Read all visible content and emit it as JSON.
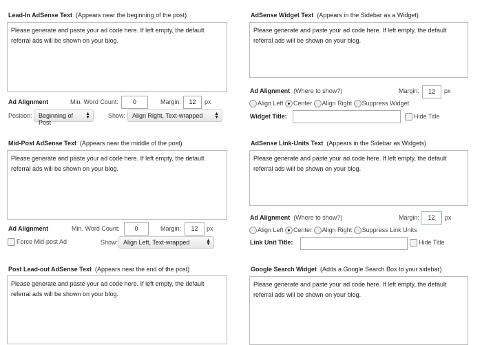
{
  "placeholder_text": "Please generate and paste your ad code here. If left empty, the default referral ads will be shown on your blog.",
  "left": {
    "leadin": {
      "title": "Lead-In AdSense Text",
      "note": "(Appears near the beginning of the post)",
      "align_label": "Ad Alignment",
      "min_word_label": "Min. Word Count:",
      "min_word": "0",
      "margin_label": "Margin:",
      "margin": "12",
      "px": "px",
      "position_label": "Position:",
      "position": "Beginning of Post",
      "show_label": "Show:",
      "show": "Align Right, Text-wrapped"
    },
    "midpost": {
      "title": "Mid-Post AdSense Text",
      "note": "(Appears near the middle of the post)",
      "align_label": "Ad Alignment",
      "min_word_label": "Min. Word Count:",
      "min_word": "0",
      "margin_label": "Margin:",
      "margin": "12",
      "px": "px",
      "force_label": "Force Mid-post Ad",
      "show_label": "Show:",
      "show": "Align Left, Text-wrapped"
    },
    "leadout": {
      "title": "Post Lead-out AdSense Text",
      "note": "(Appears near the end of the post)"
    }
  },
  "right": {
    "widget": {
      "title": "AdSense Widget Text",
      "note": "(Appears in the Sidebar as a Widget)",
      "align_label": "Ad Alignment",
      "align_note": "(Where to show?)",
      "margin_label": "Margin:",
      "margin": "12",
      "px": "px",
      "radios": [
        "Align Left",
        "Center",
        "Align Right",
        "Suppress Widget"
      ],
      "title_label": "Widget Title:",
      "hide_label": "Hide Title"
    },
    "linkunits": {
      "title": "AdSense Link-Units Text",
      "note": "(Appears in the Sidebar as Widgets)",
      "align_label": "Ad Alignment",
      "align_note": "(Where to show?)",
      "margin_label": "Margin:",
      "margin": "12",
      "px": "px",
      "radios": [
        "Align Left",
        "Center",
        "Align Right",
        "Suppress Link Units"
      ],
      "title_label": "Link Unit Title:",
      "hide_label": "Hide Title"
    },
    "search": {
      "title": "Google Search Widget",
      "note": "(Adds a Google Search Box to your sidebar)"
    }
  }
}
